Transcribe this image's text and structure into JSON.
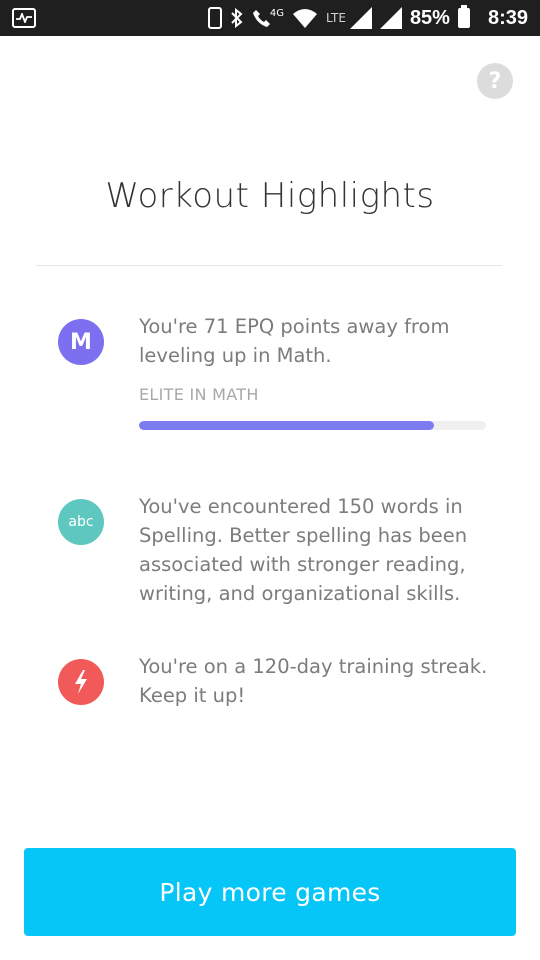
{
  "status_bar": {
    "network": "4G",
    "lte": "LTE",
    "battery": "85%",
    "time": "8:39"
  },
  "help": {
    "label": "?"
  },
  "title": "Workout Highlights",
  "highlights": [
    {
      "avatar_text": "M",
      "avatar_color": "#7c6ff0",
      "text": "You're 71 EPQ points away from leveling up in Math.",
      "level_label": "ELITE IN MATH",
      "progress": 0.85
    },
    {
      "avatar_text": "abc",
      "avatar_color": "#5ec8c0",
      "text": "You've encountered 150 words in Spelling. Better spelling has been associated with stronger reading, writing, and organizational skills."
    },
    {
      "avatar_icon": "lightning-icon",
      "avatar_color": "#f25a5a",
      "text": "You're on a 120-day training streak. Keep it up!"
    }
  ],
  "cta": {
    "label": "Play more games",
    "color": "#06c5f7"
  }
}
